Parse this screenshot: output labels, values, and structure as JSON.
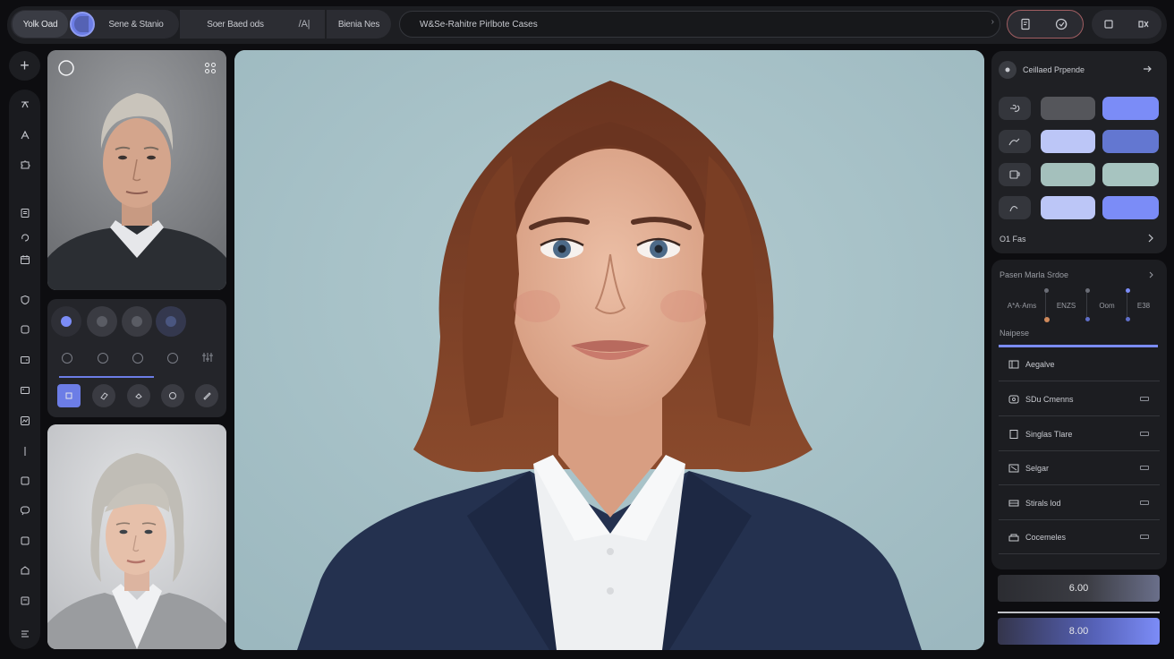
{
  "topbar": {
    "tab_voice": "Yolk Oad",
    "tab_scene": "Sene & Stanio",
    "tab_board": "Soer Baed ods",
    "board_glyph": "/A|",
    "tab_media": "Bienia Nes",
    "prompt_text": "W&Se-Rahitre Pirlbote Cases"
  },
  "right_panel": {
    "head_title": "Ceillaed Prpende",
    "footer_title": "O1 Fas",
    "section_title": "Pasen Marla Srdoe",
    "sliders": [
      "A*A·Ams",
      "ENZS",
      "Oom",
      "E38"
    ],
    "layers_title": "Naipese",
    "layers": [
      "Aegalve",
      "SDu Cmenns",
      "Singlas Tlare",
      "Selgar",
      "Stirals lod",
      "Cocemeles"
    ],
    "value1": "6.00",
    "value2": "8.00"
  },
  "swatches": {
    "colors": [
      [
        "#55565b",
        "#7b8cf7"
      ],
      [
        "#bcc6f7",
        "#6377d1"
      ],
      [
        "#a4c0bc",
        "#a7c4c0"
      ],
      [
        "#bcc6f7",
        "#7b8cf7"
      ]
    ]
  }
}
